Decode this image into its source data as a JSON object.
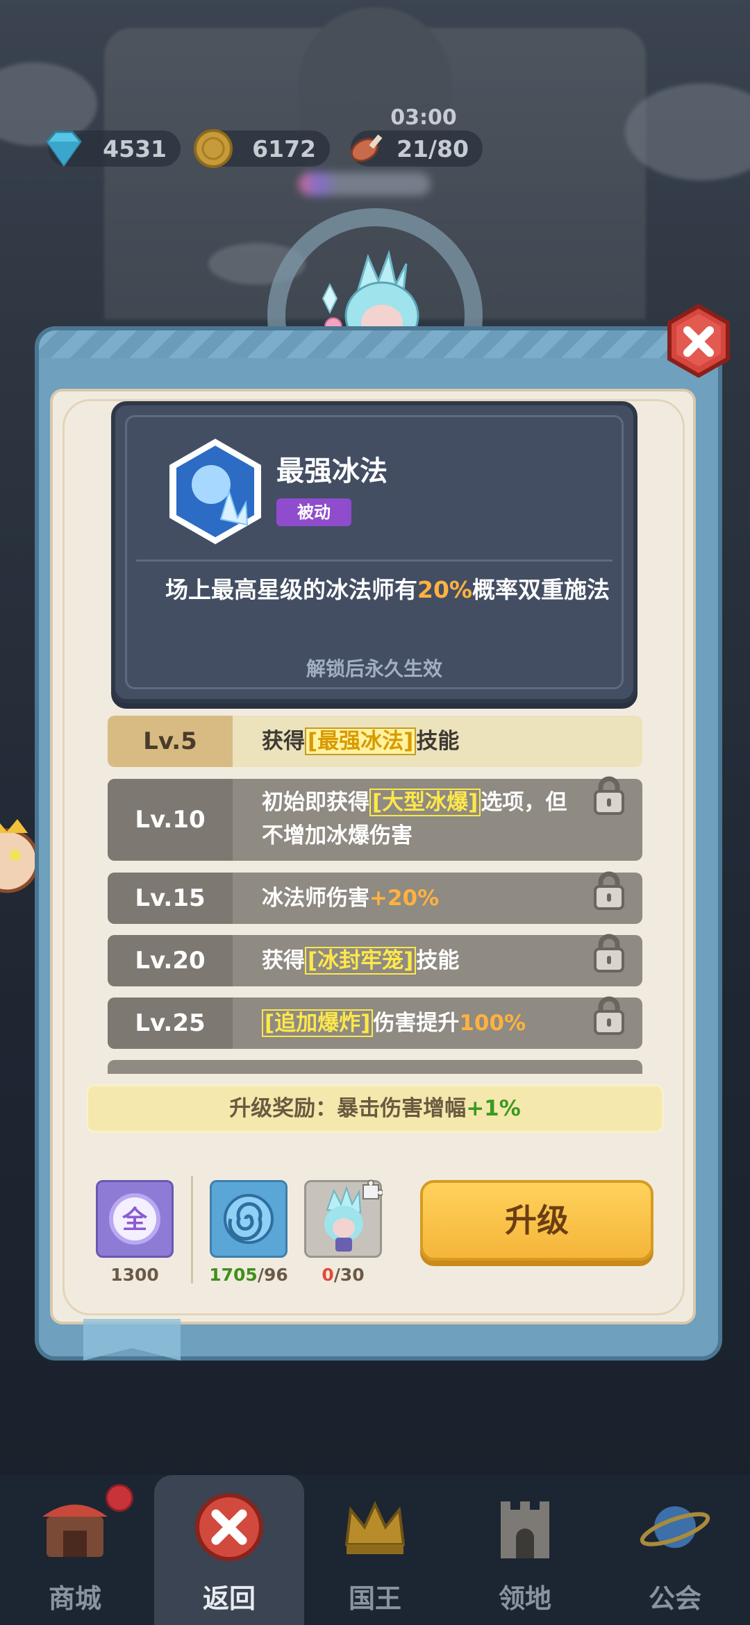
{
  "resources": {
    "gems": "4531",
    "coins": "6172",
    "stamina": "21/80",
    "timer": "03:00"
  },
  "skill": {
    "name": "最强冰法",
    "type_tag": "被动",
    "description_prefix": "场上最高星级的冰法师有",
    "description_highlight": "20%",
    "description_suffix": "概率双重施法",
    "unlock_note": "解锁后永久生效"
  },
  "levels": [
    {
      "level": "Lv.5",
      "pre": "获得",
      "keyword": "[最强冰法]",
      "post": "技能",
      "num": "",
      "locked": false
    },
    {
      "level": "Lv.10",
      "pre": "初始即获得",
      "keyword": "[大型冰爆]",
      "post": "选项，但不增加冰爆伤害",
      "num": "",
      "locked": true
    },
    {
      "level": "Lv.15",
      "pre": "冰法师伤害",
      "keyword": "",
      "post": "",
      "num": "+20%",
      "locked": true
    },
    {
      "level": "Lv.20",
      "pre": "获得",
      "keyword": "[冰封牢笼]",
      "post": "技能",
      "num": "",
      "locked": true
    },
    {
      "level": "Lv.25",
      "pre": "",
      "keyword": "[追加爆炸]",
      "post": "伤害提升",
      "num": "100%",
      "locked": true
    }
  ],
  "bonus": {
    "label": "升级奖励：暴击伤害增幅",
    "value": "+1%"
  },
  "costs": {
    "universal": "1300",
    "swirl_have": "1705",
    "swirl_need": "/96",
    "shard_have": "0",
    "shard_need": "/30",
    "universal_glyph": "全"
  },
  "upgrade_label": "升级",
  "nav": {
    "shop": "商城",
    "back": "返回",
    "king": "国王",
    "territory": "领地",
    "guild": "公会"
  },
  "colors": {
    "highlight": "#ffb23f",
    "keyword_locked": "#ffe84a",
    "bonus_plus": "#3c9a22",
    "tag_purple": "#8f4ccc"
  }
}
